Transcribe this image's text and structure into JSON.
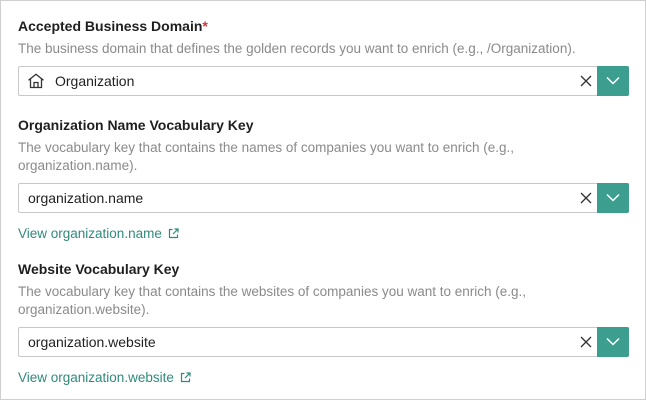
{
  "domain_field": {
    "label": "Accepted Business Domain",
    "required_mark": "*",
    "description": "The business domain that defines the golden records you want to enrich (e.g., /Organization).",
    "value": "Organization",
    "icon": "house-icon"
  },
  "name_field": {
    "label": "Organization Name Vocabulary Key",
    "description": "The vocabulary key that contains the names of companies you want to enrich (e.g., organization.name).",
    "value": "organization.name",
    "link": "View organization.name"
  },
  "website_field": {
    "label": "Website Vocabulary Key",
    "description": "The vocabulary key that contains the websites of companies you want to enrich (e.g., organization.website).",
    "value": "organization.website",
    "link": "View organization.website"
  },
  "colors": {
    "accent": "#3b9e8e",
    "link": "#2f8a7d",
    "required": "#d13438",
    "muted_text": "#8a8a8a"
  }
}
